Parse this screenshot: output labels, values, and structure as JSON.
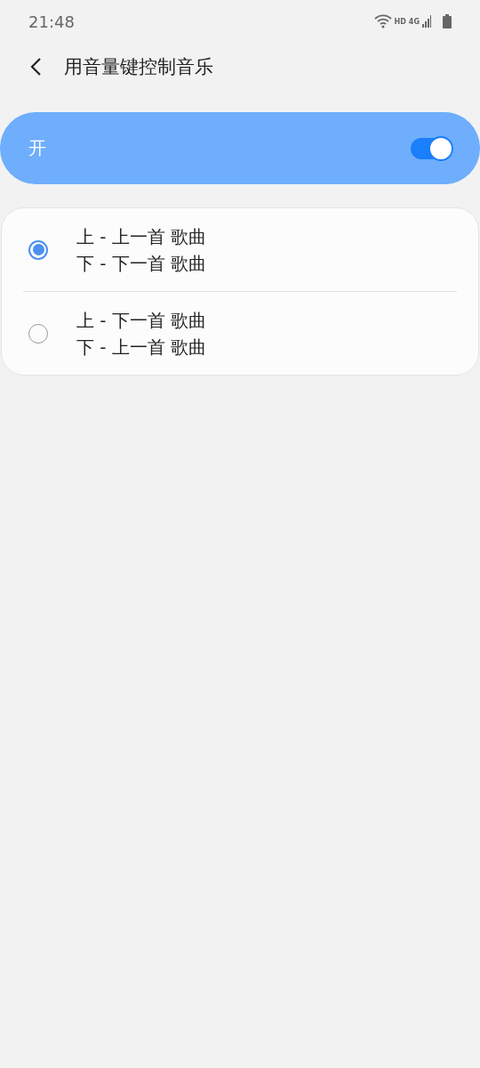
{
  "status_bar": {
    "time": "21:48",
    "network_labels": [
      "HD",
      "4G"
    ]
  },
  "header": {
    "title": "用音量键控制音乐"
  },
  "master_switch": {
    "label": "开",
    "on": true
  },
  "options": [
    {
      "lines": [
        "上 - 上一首 歌曲",
        "下 - 下一首 歌曲"
      ],
      "selected": true
    },
    {
      "lines": [
        "上 - 下一首 歌曲",
        "下 - 上一首 歌曲"
      ],
      "selected": false
    }
  ]
}
